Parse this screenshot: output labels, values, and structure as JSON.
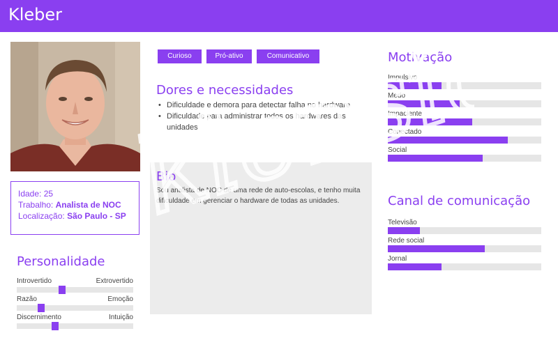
{
  "header": {
    "name": "Kleber"
  },
  "profile": {
    "age_label": "Idade:",
    "age_value": "25",
    "job_label": "Trabalho:",
    "job_value": "Analista de NOC",
    "location_label": "Localização:",
    "location_value": "São Paulo - SP"
  },
  "personality": {
    "title": "Personalidade",
    "traits": [
      {
        "left": "Introvertido",
        "right": "Extrovertido",
        "value": 0.38
      },
      {
        "left": "Razão",
        "right": "Emoção",
        "value": 0.19
      },
      {
        "left": "Discernimento",
        "right": "Intuição",
        "value": 0.32
      }
    ]
  },
  "tags": [
    "Curioso",
    "Pró-ativo",
    "Comunicativo"
  ],
  "pains": {
    "title": "Dores e necessidades",
    "items": [
      "Dificuldade e demora para detectar falha no hardware",
      "Dificuldade para administrar todos os hardwares das unidades"
    ]
  },
  "bio": {
    "title": "Bio",
    "text": "Sou analista de NOC de uma rede de auto-escolas, e tenho muita dificuldade em gerenciar o hardware de todas as unidades."
  },
  "motivation": {
    "title": "Motivação",
    "items": [
      {
        "label": "Impulsivo",
        "value": 0.35
      },
      {
        "label": "Medo",
        "value": 0.47
      },
      {
        "label": "Impaciente",
        "value": 0.55
      },
      {
        "label": "Conectado",
        "value": 0.78
      },
      {
        "label": "Social",
        "value": 0.62
      }
    ]
  },
  "channels": {
    "title": "Canal de comunicação",
    "items": [
      {
        "label": "Televisão",
        "value": 0.21
      },
      {
        "label": "Rede social",
        "value": 0.63
      },
      {
        "label": "Jornal",
        "value": 0.35
      }
    ]
  },
  "watermark": "klensio",
  "colors": {
    "accent": "#8a3ff0",
    "track": "#e6e6e6",
    "bio_bg": "#ececec"
  }
}
